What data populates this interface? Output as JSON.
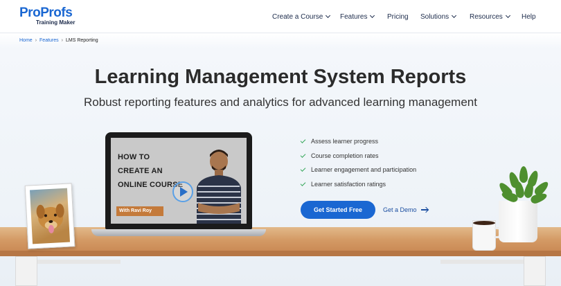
{
  "brand": {
    "name_part1": "Pro",
    "name_part2": "Profs",
    "product": "Training Maker"
  },
  "nav": [
    {
      "label": "Create a Course",
      "has_dropdown": true
    },
    {
      "label": "Features",
      "has_dropdown": true
    },
    {
      "label": "Pricing",
      "has_dropdown": false
    },
    {
      "label": "Solutions",
      "has_dropdown": true
    },
    {
      "label": "Resources",
      "has_dropdown": true
    },
    {
      "label": "Help",
      "has_dropdown": false
    }
  ],
  "breadcrumb": {
    "home": "Home",
    "features": "Features",
    "current": "LMS Reporting"
  },
  "hero": {
    "title": "Learning Management System Reports",
    "subtitle": "Robust reporting features and analytics for advanced learning management"
  },
  "video": {
    "line1": "HOW TO",
    "line2": "CREATE AN",
    "line3": "ONLINE COURSE",
    "presenter": "With Ravi Roy"
  },
  "features": [
    "Assess learner progress",
    "Course completion rates",
    "Learner engagement and participation",
    "Learner satisfaction ratings"
  ],
  "cta": {
    "primary": "Get Started Free",
    "secondary": "Get a Demo"
  },
  "colors": {
    "brand_blue": "#1a67d2",
    "check_green": "#37a85b",
    "navy": "#1b2a4a"
  },
  "icons": {
    "feature_bullet": "check-icon",
    "demo_link": "arrow-right-icon",
    "nav_dropdown": "chevron-down-icon",
    "video": "play-icon"
  }
}
